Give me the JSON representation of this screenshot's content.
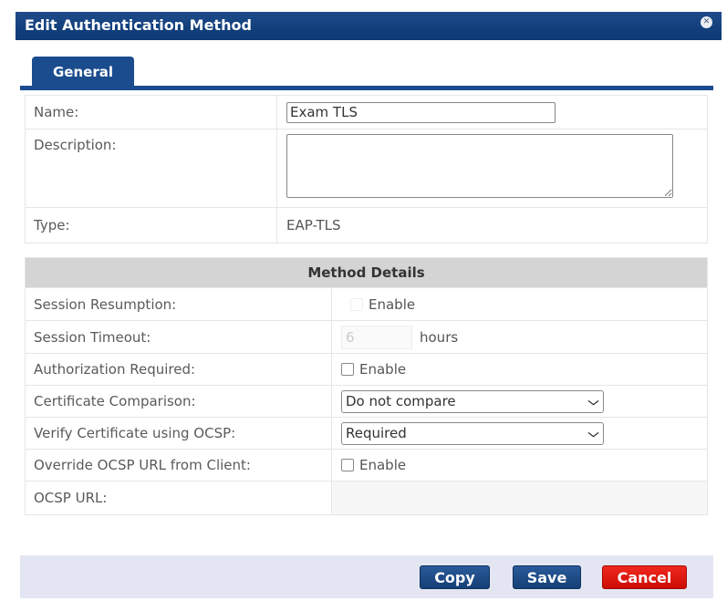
{
  "dialog": {
    "title": "Edit Authentication Method",
    "close_icon": "close-icon"
  },
  "tabs": [
    {
      "label": "General",
      "active": true
    }
  ],
  "general": {
    "name_label": "Name:",
    "name_value": "Exam TLS",
    "description_label": "Description:",
    "description_value": "",
    "type_label": "Type:",
    "type_value": "EAP-TLS"
  },
  "method_details": {
    "header": "Method Details",
    "session_resumption": {
      "label": "Session Resumption:",
      "checkbox_label": "Enable",
      "checked": false,
      "disabled": true
    },
    "session_timeout": {
      "label": "Session Timeout:",
      "value": "6",
      "unit": "hours",
      "disabled": true
    },
    "authorization_required": {
      "label": "Authorization Required:",
      "checkbox_label": "Enable",
      "checked": false
    },
    "certificate_comparison": {
      "label": "Certificate Comparison:",
      "selected": "Do not compare"
    },
    "verify_ocsp": {
      "label": "Verify Certificate using OCSP:",
      "selected": "Required"
    },
    "override_ocsp_url": {
      "label": "Override OCSP URL from Client:",
      "checkbox_label": "Enable",
      "checked": false
    },
    "ocsp_url": {
      "label": "OCSP URL:",
      "value": ""
    }
  },
  "footer": {
    "copy_label": "Copy",
    "save_label": "Save",
    "cancel_label": "Cancel"
  },
  "colors": {
    "title_bar": "#123f7c",
    "tab": "#1b4c8e",
    "button_blue": "#1d4a86",
    "button_red": "#e31a12",
    "footer_bg": "#e3e6f2"
  }
}
